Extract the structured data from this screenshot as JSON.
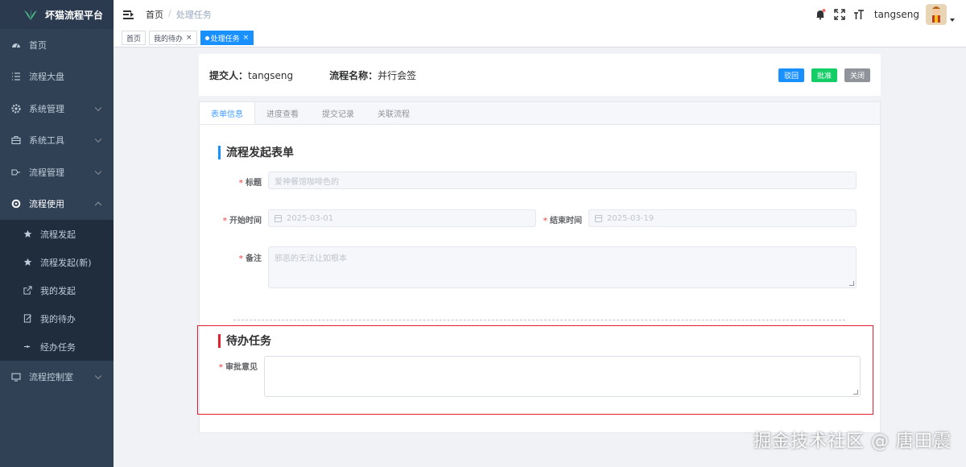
{
  "app": {
    "title": "坏猫流程平台"
  },
  "sidebar": {
    "items": [
      {
        "label": "首页",
        "icon": "dashboard-icon"
      },
      {
        "label": "流程大盘",
        "icon": "list-icon"
      },
      {
        "label": "系统管理",
        "icon": "gear-icon"
      },
      {
        "label": "系统工具",
        "icon": "toolbox-icon"
      },
      {
        "label": "流程管理",
        "icon": "flow-icon"
      },
      {
        "label": "流程使用",
        "icon": "cog-icon"
      }
    ],
    "sub_items": [
      {
        "label": "流程发起",
        "icon": "star-icon"
      },
      {
        "label": "流程发起(新)",
        "icon": "star-icon"
      },
      {
        "label": "我的发起",
        "icon": "external-link-icon"
      },
      {
        "label": "我的待办",
        "icon": "edit-doc-icon"
      },
      {
        "label": "经办任务",
        "icon": "arrow-icon"
      }
    ],
    "last_item": {
      "label": "流程控制室",
      "icon": "monitor-icon"
    }
  },
  "header": {
    "breadcrumb": [
      "首页",
      "处理任务"
    ],
    "username": "tangseng"
  },
  "tags": [
    {
      "label": "首页"
    },
    {
      "label": "我的待办",
      "close": "×"
    },
    {
      "label": "处理任务",
      "close": "×"
    }
  ],
  "summary": {
    "submitter_label": "提交人：",
    "submitter": "tangseng",
    "flow_name_label": "流程名称：",
    "flow_name": "并行会签",
    "buttons": {
      "reject": "驳回",
      "approve": "批准",
      "close": "关闭"
    }
  },
  "tabs": [
    "表单信息",
    "进度查看",
    "提交记录",
    "关联流程"
  ],
  "form": {
    "section_title": "流程发起表单",
    "title_label": "标题",
    "title_value": "爱神餐馆咖啡色的",
    "start_label": "开始时间",
    "start_value": "2025-03-01",
    "end_label": "结束时间",
    "end_value": "2025-03-19",
    "remark_label": "备注",
    "remark_value": "邪恶的无法让如根本",
    "required_mark": "*"
  },
  "task": {
    "section_title": "待办任务",
    "opinion_label": "审批意见",
    "opinion_value": ""
  },
  "watermark": "掘金技术社区 @ 唐田震",
  "colors": {
    "sidebar": "#304156",
    "accent": "#1890ff",
    "approve": "#13ce66",
    "highlight": "#e3202f"
  }
}
